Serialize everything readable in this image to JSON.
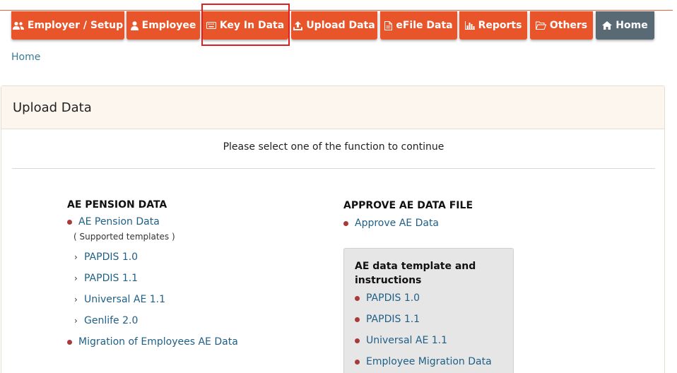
{
  "nav": {
    "items": [
      {
        "label": "Employer / Setup",
        "icon": "users-icon"
      },
      {
        "label": "Employee",
        "icon": "user-icon"
      },
      {
        "label": "Key In Data",
        "icon": "keyboard-icon"
      },
      {
        "label": "Upload Data",
        "icon": "upload-icon"
      },
      {
        "label": "eFile Data",
        "icon": "file-icon"
      },
      {
        "label": "Reports",
        "icon": "bar-chart-icon"
      },
      {
        "label": "Others",
        "icon": "folder-open-icon"
      },
      {
        "label": "Home",
        "icon": "home-icon"
      }
    ],
    "accent_color": "#e8552a",
    "home_color": "#5a6a74"
  },
  "breadcrumb": {
    "label": "Home"
  },
  "panel": {
    "title": "Upload Data",
    "intro": "Please select one of the function to continue"
  },
  "pension": {
    "title": "AE PENSION DATA",
    "main_link": "AE Pension Data",
    "note": "( Supported templates )",
    "templates": [
      "PAPDIS 1.0",
      "PAPDIS 1.1",
      "Universal AE 1.1",
      "Genlife 2.0"
    ],
    "migration_link": "Migration of Employees AE Data"
  },
  "approve": {
    "title": "APPROVE AE DATA FILE",
    "link": "Approve AE Data"
  },
  "template_box": {
    "title_line1": "AE data template and",
    "title_line2": "instructions",
    "links": [
      "PAPDIS 1.0",
      "PAPDIS 1.1",
      "Universal AE 1.1",
      "Employee Migration Data"
    ]
  }
}
